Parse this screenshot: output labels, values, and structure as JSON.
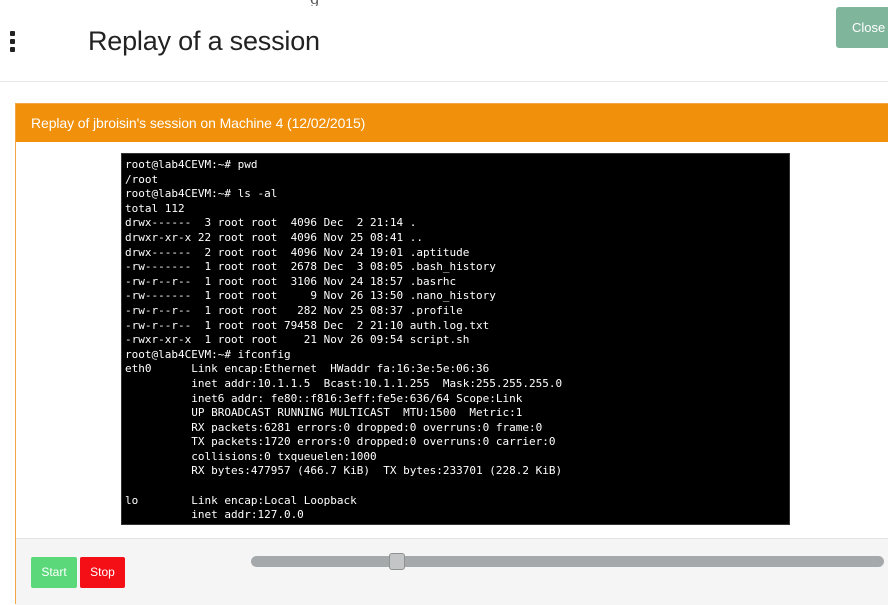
{
  "top_fragment": "g",
  "header": {
    "title": "Replay of a session",
    "close_label": "Close"
  },
  "panel": {
    "heading": "Replay of jbroisin's session on Machine 4 (12/02/2015)"
  },
  "terminal": {
    "lines": [
      "root@lab4CEVM:~# pwd",
      "/root",
      "root@lab4CEVM:~# ls -al",
      "total 112",
      "drwx------  3 root root  4096 Dec  2 21:14 .",
      "drwxr-xr-x 22 root root  4096 Nov 25 08:41 ..",
      "drwx------  2 root root  4096 Nov 24 19:01 .aptitude",
      "-rw-------  1 root root  2678 Dec  3 08:05 .bash_history",
      "-rw-r--r--  1 root root  3106 Nov 24 18:57 .basrhc",
      "-rw-------  1 root root     9 Nov 26 13:50 .nano_history",
      "-rw-r--r--  1 root root   282 Nov 25 08:37 .profile",
      "-rw-r--r--  1 root root 79458 Dec  2 21:10 auth.log.txt",
      "-rwxr-xr-x  1 root root    21 Nov 26 09:54 script.sh",
      "root@lab4CEVM:~# ifconfig",
      "eth0      Link encap:Ethernet  HWaddr fa:16:3e:5e:06:36",
      "          inet addr:10.1.1.5  Bcast:10.1.1.255  Mask:255.255.255.0",
      "          inet6 addr: fe80::f816:3eff:fe5e:636/64 Scope:Link",
      "          UP BROADCAST RUNNING MULTICAST  MTU:1500  Metric:1",
      "          RX packets:6281 errors:0 dropped:0 overruns:0 frame:0",
      "          TX packets:1720 errors:0 dropped:0 overruns:0 carrier:0",
      "          collisions:0 txqueuelen:1000",
      "          RX bytes:477957 (466.7 KiB)  TX bytes:233701 (228.2 KiB)",
      "",
      "lo        Link encap:Local Loopback",
      "          inet addr:127.0.0"
    ]
  },
  "controls": {
    "start_label": "Start",
    "stop_label": "Stop",
    "progress_fraction": 0.23
  },
  "colors": {
    "panel_heading": "#f0900b",
    "close_button": "#7fb59b",
    "start_button": "#5bd87a",
    "stop_button": "#f40f17",
    "terminal_bg": "#000000"
  },
  "icons": {
    "menu": "kebab-menu-icon"
  }
}
